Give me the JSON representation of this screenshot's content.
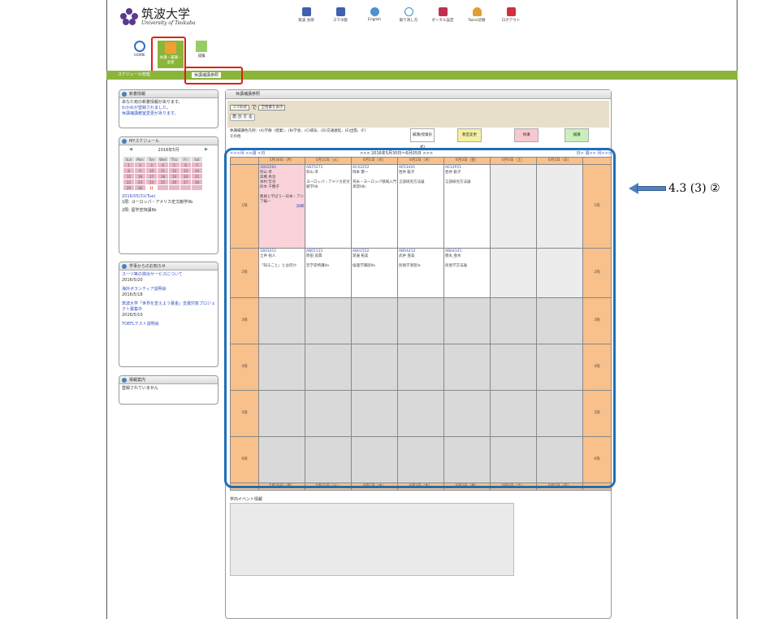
{
  "header": {
    "logo_jp": "筑波大学",
    "logo_en": "University of Tsukuba"
  },
  "topnav": [
    {
      "label": "筑波 太郎",
      "color": "#4060b0"
    },
    {
      "label": "スマホ版",
      "color": "#4060b0"
    },
    {
      "label": "English",
      "color": "#5090d0"
    },
    {
      "label": "取り消し方",
      "color": "#4090c0"
    },
    {
      "label": "ポータル設定",
      "color": "#c03050"
    },
    {
      "label": "Twins切替",
      "color": "#e0a030"
    },
    {
      "label": "ログアウト",
      "color": "#d03040"
    }
  ],
  "secnav": [
    {
      "label": "HOME"
    },
    {
      "label": "休講・補講・変更",
      "active": true
    },
    {
      "label": "成績"
    }
  ],
  "breadcrumb": {
    "first": "スケジュール管理",
    "second": "休講補講参照"
  },
  "sidebar": {
    "notice": {
      "title": "新着情報",
      "lines": [
        "あなた宛の新着情報があります。",
        "わかめが登録されました。",
        "休講補講教室変更があります。"
      ]
    },
    "myschedule": {
      "title": "MYスケジュール",
      "month": "2016年5月",
      "weekdays": [
        "Sun",
        "Mon",
        "Tue",
        "Wed",
        "Thu",
        "Fri",
        "Sat"
      ],
      "weeks": [
        [
          "1",
          "2",
          "3",
          "4",
          "5",
          "6",
          "7"
        ],
        [
          "8",
          "9",
          "10",
          "11",
          "12",
          "13",
          "14"
        ],
        [
          "15",
          "16",
          "17",
          "18",
          "19",
          "20",
          "21"
        ],
        [
          "22",
          "23",
          "24",
          "25",
          "26",
          "27",
          "28"
        ],
        [
          "29",
          "30",
          "31",
          "",
          "",
          "",
          ""
        ]
      ],
      "date_line": "2016/05/31(Tue)",
      "item1": "1限: ヨーロッパ・アメリカ史文献学IIb",
      "item2": "2限: 留学史特講IIb"
    },
    "news": {
      "title": "学事からのお知らせ",
      "items": [
        {
          "t": "スーツ等の貸出サービスについて",
          "d": "2016/5/20"
        },
        {
          "t": "海外ボランティア説明会",
          "d": "2016/5/18"
        },
        {
          "t": "筑波大学「世界を変えよう募金」支援対象プロジェクト募集中",
          "d": "2016/5/10"
        },
        {
          "t": "TOEFLテスト説明会",
          "d": ""
        }
      ]
    },
    "links": {
      "title": "掲載案内",
      "text": "登録されていません"
    }
  },
  "main": {
    "title": "休講補講参照",
    "select1": "コマ形式",
    "label_de": "で",
    "select2": "全授業を表示",
    "show_btn": "表 示 す る",
    "legend": "休講補講色凡例：(A)学群（授業）、(B)学会、(C)病気、(D)交通遅延、(E)出張、(F)その他",
    "legend_btns": [
      "補講(授業形式)",
      "教室変更",
      "休講",
      "補講"
    ],
    "nav": {
      "prev_month": "<<<月",
      "prev_week": "<<週",
      "prev_day": "<日",
      "range": "<<< 2016年5月30日～6月05日 >>>",
      "next_day": "日>",
      "next_week": "週>>",
      "next_month": "月>>>"
    },
    "days": [
      "5月30日（月）",
      "5月31日（火）",
      "6月1日（水）",
      "6月2日（木）",
      "6月3日（金）",
      "6月4日（土）",
      "6月5日（日）"
    ],
    "periods": [
      "1限",
      "2限",
      "3限",
      "4限",
      "5限",
      "6限"
    ],
    "row1": [
      {
        "code": "1B02261",
        "lines": [
          "狩山 孝",
          "高橋 秀治",
          "本村 哲也",
          "鈴木 千穂子",
          "",
          "教員と学ぼう―日本・アジア編―"
        ],
        "link": "詳細",
        "type": "p"
      },
      {
        "code": "AB75271",
        "lines": [
          "狩山 孝",
          "",
          "ヨーロッパ・アメリカ史文献学IIb"
        ],
        "type": "w"
      },
      {
        "code": "AC43252",
        "lines": [
          "岡本 憲一",
          "",
          "英米・ヨーロッパ領域入門演習IIIb"
        ],
        "type": "w"
      },
      {
        "code": "AE53441",
        "lines": [
          "岩井 聡子",
          "",
          "言語研究方法論"
        ],
        "type": "w"
      },
      {
        "code": "AE12P21",
        "lines": [
          "岩井 聡子",
          "",
          "言語研究方法論"
        ],
        "type": "w"
      },
      {
        "code": "",
        "lines": [],
        "type": "g"
      },
      {
        "code": "",
        "lines": [],
        "type": "g"
      }
    ],
    "row2": [
      {
        "code": "1B01011",
        "lines": [
          "土井 祐人",
          "",
          "「知ること」とは何か"
        ],
        "type": "w"
      },
      {
        "code": "AB01131",
        "lines": [
          "原田 良典",
          "",
          "哲学史特講IIa"
        ],
        "type": "w"
      },
      {
        "code": "AB01552",
        "lines": [
          "渡邊 拓美",
          "",
          "倫理学講読IIa"
        ],
        "type": "w"
      },
      {
        "code": "AB04412",
        "lines": [
          "武井 亜美",
          "",
          "民俗学演習Ia"
        ],
        "type": "w"
      },
      {
        "code": "AB04141",
        "lines": [
          "徳丸 亜木",
          "",
          "民俗学方法論"
        ],
        "type": "w"
      },
      {
        "code": "",
        "lines": [],
        "type": "g"
      },
      {
        "code": "",
        "lines": [],
        "type": "g"
      }
    ],
    "event_label": "学内イベント情報"
  },
  "annotation": {
    "text": "4.3 (3) ②"
  }
}
